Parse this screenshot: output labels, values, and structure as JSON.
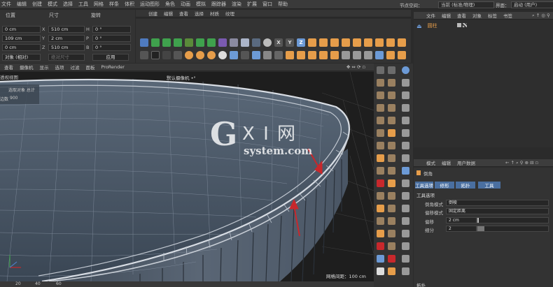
{
  "menu": [
    "文件",
    "编辑",
    "创建",
    "模式",
    "选择",
    "工具",
    "网格",
    "样条",
    "体积",
    "运动图形",
    "角色",
    "动画",
    "模拟",
    "跟踪器",
    "渲染",
    "扩展",
    "窗口",
    "帮助"
  ],
  "layout_label": "节点空间：",
  "layout_value": "当前 (标准/物理)",
  "interface_label": "界面：",
  "interface_value": "启动 (用户)",
  "coord": {
    "headers": [
      "位置",
      "尺寸",
      "旋转"
    ],
    "rows": [
      {
        "pos": "0 cm",
        "ax1": "X",
        "size": "510 cm",
        "ax2": "H",
        "rot": "0 °"
      },
      {
        "pos": "109 cm",
        "ax1": "Y",
        "size": "2 cm",
        "ax2": "P",
        "rot": "0 °"
      },
      {
        "pos": "0 cm",
        "ax1": "Z",
        "size": "510 cm",
        "ax2": "B",
        "rot": "0 °"
      }
    ],
    "mode": "对象 (相对)",
    "size_mode": "绝对尺寸",
    "apply": "应用"
  },
  "edit_menu": [
    "创建",
    "编辑",
    "查看",
    "选择",
    "材质",
    "纹理"
  ],
  "axes_letters": [
    "X",
    "Y",
    "Z"
  ],
  "viewport": {
    "menu": [
      "查看",
      "摄像机",
      "显示",
      "选项",
      "过滤",
      "面板",
      "ProRender"
    ],
    "left_label": "透视视图",
    "title": "默认摄像机 •°",
    "info": [
      {
        "k": "",
        "v": "选取对象 总计"
      },
      {
        "k": "边数",
        "v": "900"
      }
    ],
    "grid": "网格间距：100 cm"
  },
  "objects": {
    "menu": [
      "文件",
      "编辑",
      "查看",
      "对象",
      "标签",
      "书签"
    ],
    "item": "圆柱"
  },
  "attr": {
    "menu": [
      "模式",
      "编辑",
      "用户数据"
    ],
    "title": "倒角",
    "tabs": [
      "工具选项",
      "修形",
      "拓扑",
      "工具"
    ],
    "section": "工具选项",
    "fields": [
      {
        "label": "倒角模式",
        "value": "倒棱"
      },
      {
        "label": "偏移模式",
        "value": "固定距离"
      },
      {
        "label": "偏移",
        "value": "2 cm"
      },
      {
        "label": "细分",
        "value": "2"
      }
    ],
    "bottom": "拓扑"
  },
  "timeline": [
    "20",
    "40",
    "60"
  ],
  "watermark": {
    "g": "G",
    "xi": "X I 网",
    "sub": "system.com"
  },
  "colors": {
    "accent": "#4a6fa0",
    "bg": "#2b2b2b",
    "panel": "#333333",
    "blue": "#6c9ad6",
    "orange": "#e69d4a",
    "red": "#c8282c"
  }
}
